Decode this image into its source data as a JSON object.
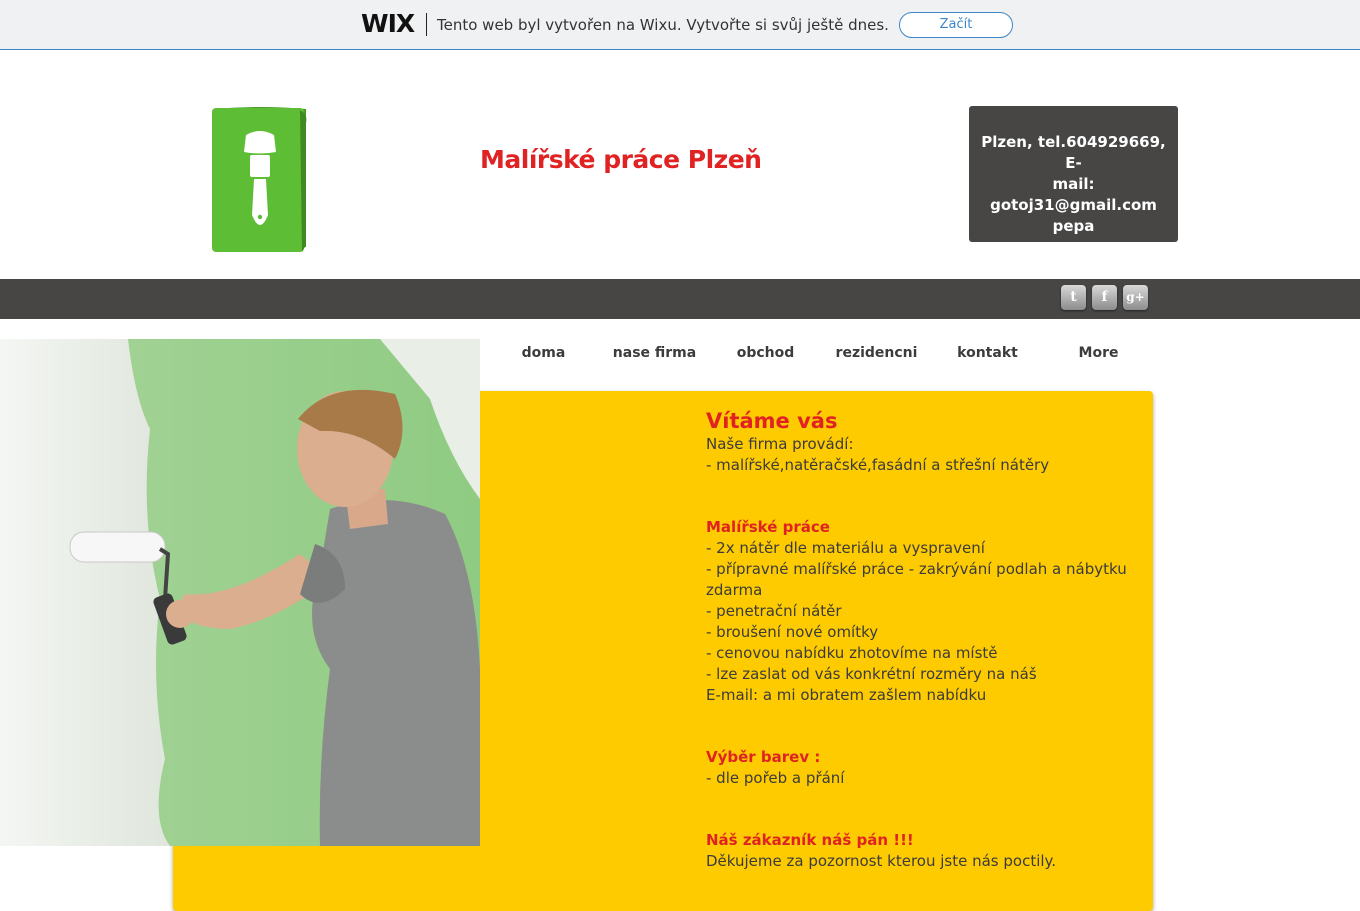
{
  "wix_banner": {
    "logo": "WIX",
    "text": "Tento web byl vytvořen na Wixu. Vytvořte si svůj ještě dnes.",
    "button_label": "Začít"
  },
  "header": {
    "title": "Malířské práce Plzeň",
    "contact_lines": [
      "Plzen, tel.604929669, E-",
      "mail:",
      "gotoj31@gmail.com",
      "pepa"
    ]
  },
  "social": {
    "twitter": "t",
    "facebook": "f",
    "google": "g+"
  },
  "nav": {
    "items": [
      "doma",
      "nase firma",
      "obchod",
      "rezidencni",
      "kontakt",
      "More"
    ]
  },
  "content": {
    "welcome": "Vítáme vás",
    "intro": [
      "Naše firma provádí:",
      "- malířské,natěračské,fasádní a střešní nátěry"
    ],
    "section1_title": "Malířské práce",
    "section1_lines": [
      "- 2x nátěr dle materiálu a vyspravení",
      "- přípravné malířské práce - zakrývání podlah a nábytku zdarma",
      "- penetrační nátěr",
      "- broušení nové omítky",
      "- cenovou nabídku zhotovíme na místě",
      "- lze zaslat od vás konkrétní rozměry na náš",
      "E-mail: a mi obratem zašlem nabídku"
    ],
    "section2_title": "Výběr barev :",
    "section2_lines": [
      "- dle pořeb a přání"
    ],
    "section3_title": "Náš zákazník náš pán !!!",
    "section3_lines": [
      "Děkujeme za pozornost kterou jste nás poctily."
    ]
  },
  "colors": {
    "accent_red": "#e02223",
    "content_yellow": "#fecb00",
    "dark_bar": "#474645",
    "wix_blue": "#3f86c9",
    "logo_green": "#5dbd34"
  }
}
